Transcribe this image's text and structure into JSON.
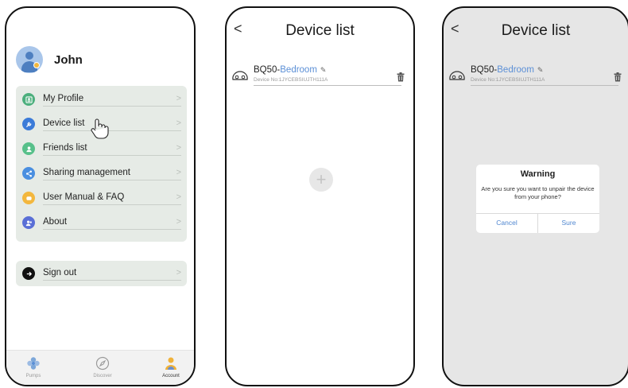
{
  "account": {
    "user_name": "John",
    "menu": [
      {
        "label": "My Profile",
        "icon": "profile-icon",
        "color": "#4caf7d"
      },
      {
        "label": "Device list",
        "icon": "wrench-icon",
        "color": "#3b7bd8"
      },
      {
        "label": "Friends list",
        "icon": "friends-icon",
        "color": "#57c08a"
      },
      {
        "label": "Sharing management",
        "icon": "share-icon",
        "color": "#4a8fe0"
      },
      {
        "label": "User Manual & FAQ",
        "icon": "manual-icon",
        "color": "#f3b73e"
      },
      {
        "label": "About",
        "icon": "about-icon",
        "color": "#5a6fd6"
      }
    ],
    "sign_out": "Sign out",
    "tabs": [
      {
        "label": "Pumps",
        "icon": "pump-icon"
      },
      {
        "label": "Discover",
        "icon": "compass-icon"
      },
      {
        "label": "Account",
        "icon": "account-icon"
      }
    ]
  },
  "device_list": {
    "title": "Device list",
    "back": "<",
    "device": {
      "model": "BQ50-",
      "room": "Bedroom",
      "serial": "Device No:1JYCEBSIUJTH111A"
    },
    "add": "+"
  },
  "dialog": {
    "title": "Warning",
    "message": "Are you sure you want to unpair the device from your phone?",
    "cancel": "Cancel",
    "sure": "Sure"
  },
  "colors": {
    "accent": "#4f86d0",
    "card_bg": "#e6ebe6",
    "overlay_bg": "#e6e6e6"
  }
}
